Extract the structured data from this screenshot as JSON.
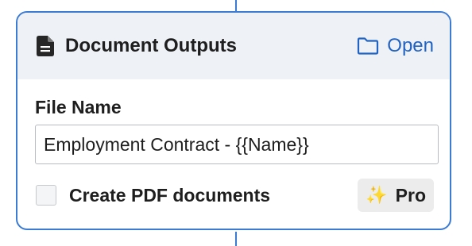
{
  "card": {
    "title": "Document Outputs",
    "open_label": "Open",
    "header_icon": "document-icon",
    "open_icon": "folder-icon"
  },
  "file_name": {
    "label": "File Name",
    "value": "Employment Contract - {{Name}}"
  },
  "pdf": {
    "label": "Create PDF documents",
    "checked": false
  },
  "pro_badge": {
    "label": "Pro",
    "icon": "sparkles-icon"
  },
  "colors": {
    "accent": "#3b7bd3",
    "link": "#2063c3",
    "header_bg": "#eef1f5"
  }
}
